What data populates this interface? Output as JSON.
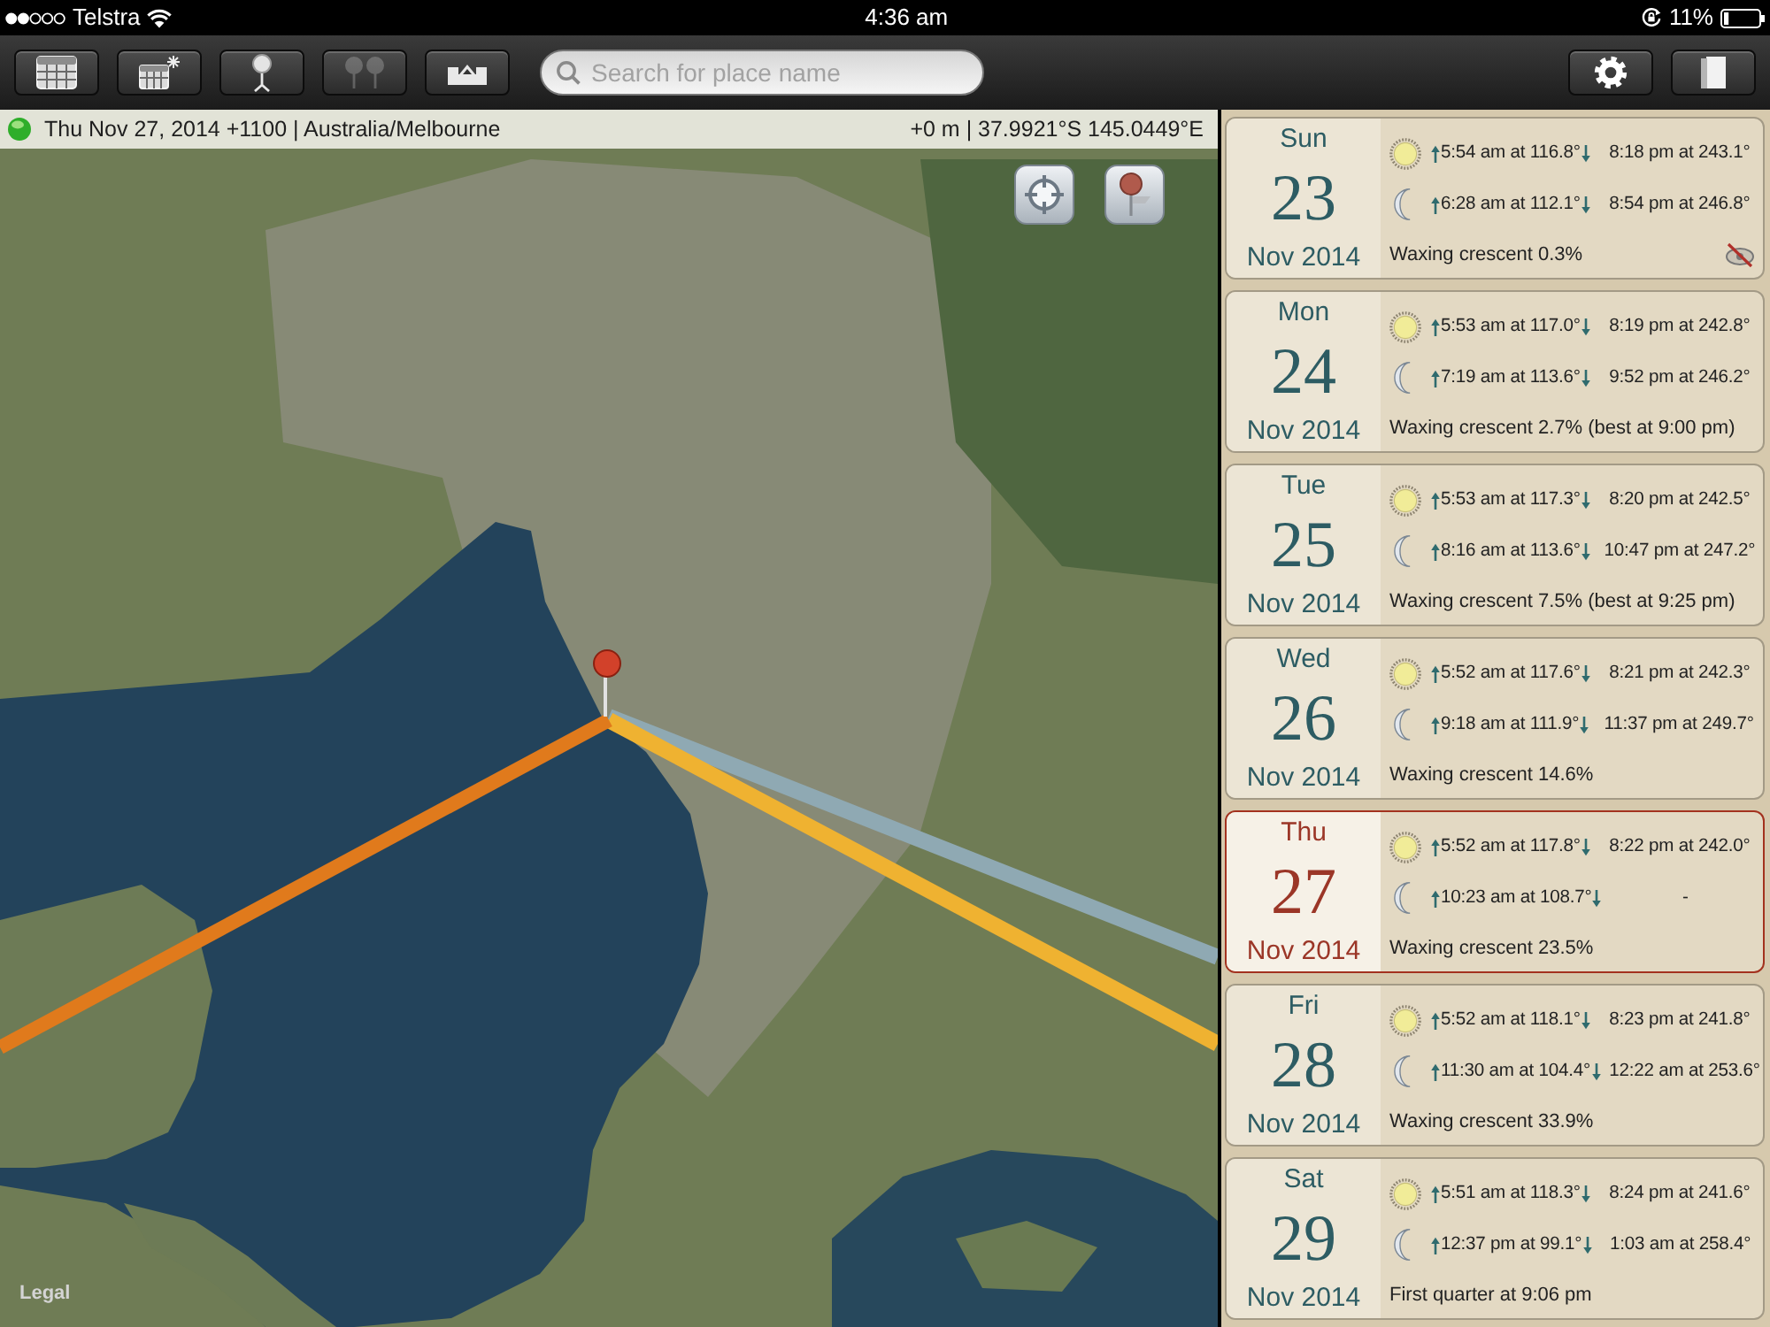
{
  "status_bar": {
    "carrier": "Telstra",
    "time": "4:36 am",
    "battery": "11%"
  },
  "toolbar": {
    "buttons": [
      {
        "disabled": false
      },
      {
        "disabled": false
      },
      {
        "disabled": false
      },
      {
        "disabled": true
      },
      {
        "disabled": false
      }
    ],
    "search": {
      "placeholder": "Search for place name"
    }
  },
  "info_bar": {
    "datetime": "Thu Nov 27, 2014 +1100 | Australia/Melbourne",
    "location": "+0 m | 37.9921°S 145.0449°E"
  },
  "map": {
    "legal": "Legal"
  },
  "days": [
    {
      "weekday": "Sun",
      "day": "23",
      "month": "Nov 2014",
      "selected": false,
      "sun": {
        "rise": "5:54 am at 116.8°",
        "set": "8:18 pm at 243.1°"
      },
      "moon": {
        "rise": "6:28 am at 112.1°",
        "set": "8:54 pm at 246.8°"
      },
      "phase": "Waxing crescent 0.3%",
      "moon_not_visible": true
    },
    {
      "weekday": "Mon",
      "day": "24",
      "month": "Nov 2014",
      "selected": false,
      "sun": {
        "rise": "5:53 am at 117.0°",
        "set": "8:19 pm at 242.8°"
      },
      "moon": {
        "rise": "7:19 am at 113.6°",
        "set": "9:52 pm at 246.2°"
      },
      "phase": "Waxing crescent 2.7% (best at 9:00 pm)",
      "moon_not_visible": false
    },
    {
      "weekday": "Tue",
      "day": "25",
      "month": "Nov 2014",
      "selected": false,
      "sun": {
        "rise": "5:53 am at 117.3°",
        "set": "8:20 pm at 242.5°"
      },
      "moon": {
        "rise": "8:16 am at 113.6°",
        "set": "10:47 pm at 247.2°"
      },
      "phase": "Waxing crescent 7.5% (best at 9:25 pm)",
      "moon_not_visible": false
    },
    {
      "weekday": "Wed",
      "day": "26",
      "month": "Nov 2014",
      "selected": false,
      "sun": {
        "rise": "5:52 am at 117.6°",
        "set": "8:21 pm at 242.3°"
      },
      "moon": {
        "rise": "9:18 am at 111.9°",
        "set": "11:37 pm at 249.7°"
      },
      "phase": "Waxing crescent 14.6%",
      "moon_not_visible": false
    },
    {
      "weekday": "Thu",
      "day": "27",
      "month": "Nov 2014",
      "selected": true,
      "sun": {
        "rise": "5:52 am at 117.8°",
        "set": "8:22 pm at 242.0°"
      },
      "moon": {
        "rise": "10:23 am at 108.7°",
        "set": "-"
      },
      "phase": "Waxing crescent 23.5%",
      "moon_not_visible": false
    },
    {
      "weekday": "Fri",
      "day": "28",
      "month": "Nov 2014",
      "selected": false,
      "sun": {
        "rise": "5:52 am at 118.1°",
        "set": "8:23 pm at 241.8°"
      },
      "moon": {
        "rise": "11:30 am at 104.4°",
        "set": "12:22 am at 253.6°"
      },
      "phase": "Waxing crescent 33.9%",
      "moon_not_visible": false
    },
    {
      "weekday": "Sat",
      "day": "29",
      "month": "Nov 2014",
      "selected": false,
      "sun": {
        "rise": "5:51 am at 118.3°",
        "set": "8:24 pm at 241.6°"
      },
      "moon": {
        "rise": "12:37 pm at 99.1°",
        "set": "1:03 am at 258.4°"
      },
      "phase": "First quarter at 9:06 pm",
      "moon_not_visible": false
    }
  ]
}
